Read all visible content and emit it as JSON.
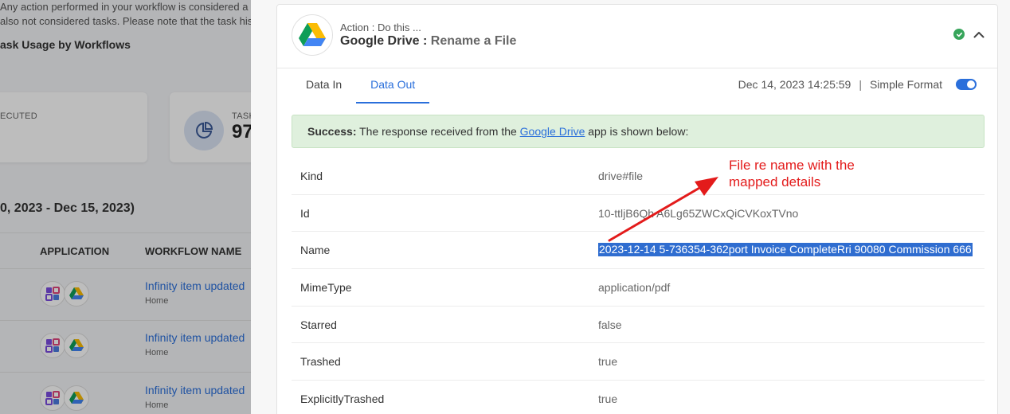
{
  "background": {
    "note_line1": "Any action performed in your workflow is considered a",
    "note_line2": "also not considered tasks. Please note that the task histo",
    "section_heading": "ask Usage by Workflows",
    "card1_label": "ECUTED",
    "card2_label": "TASK",
    "card2_value": "97",
    "date_range": "0, 2023 - Dec 15, 2023)",
    "table_headers": {
      "application": "APPLICATION",
      "workflow_name": "WORKFLOW NAME"
    },
    "rows": [
      {
        "workflow": "Infinity item updated",
        "sub": "Home"
      },
      {
        "workflow": "Infinity item updated",
        "sub": "Home"
      },
      {
        "workflow": "Infinity item updated",
        "sub": "Home"
      }
    ]
  },
  "step": {
    "action_label": "Action : Do this ...",
    "app_name": "Google Drive",
    "separator": " : ",
    "action_name": "Rename a File",
    "status_icon": "check-circle-icon",
    "colors": {
      "accent": "#2a6fdb",
      "success": "#37a55b",
      "annotation": "#e31b1b"
    }
  },
  "tabs": [
    {
      "label": "Data In",
      "active": false
    },
    {
      "label": "Data Out",
      "active": true
    }
  ],
  "meta": {
    "timestamp": "Dec 14, 2023 14:25:59",
    "separator": "|",
    "format_label": "Simple Format",
    "simple_format_on": true
  },
  "success": {
    "prefix": "Success:",
    "text_before": " The response received from the ",
    "link": "Google Drive",
    "text_after": " app is shown below:"
  },
  "response": [
    {
      "key": "Kind",
      "value": "drive#file"
    },
    {
      "key": "Id",
      "value": "10-ttljB6Qh  A6Lg65ZWCxQiCVKoxTVno"
    },
    {
      "key": "Name",
      "value": "2023-12-14 5-736354-362port Invoice CompleteRri 90080 Commission 666"
    },
    {
      "key": "MimeType",
      "value": "application/pdf"
    },
    {
      "key": "Starred",
      "value": "false"
    },
    {
      "key": "Trashed",
      "value": "true"
    },
    {
      "key": "ExplicitlyTrashed",
      "value": "true"
    }
  ],
  "annotation": {
    "line1": "File re name with the",
    "line2": "mapped details"
  }
}
